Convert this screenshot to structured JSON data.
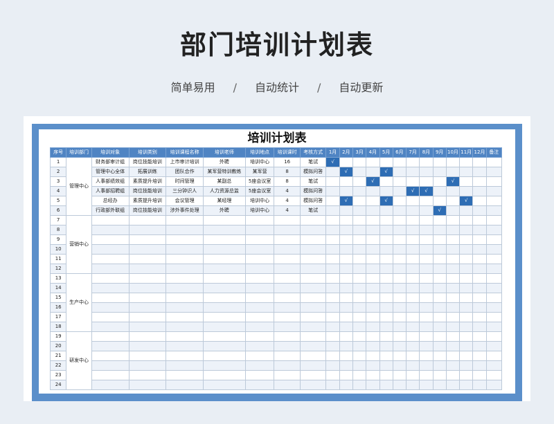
{
  "page": {
    "title": "部门培训计划表",
    "tags": [
      "简单易用",
      "自动统计",
      "自动更新"
    ],
    "separator": "/"
  },
  "sheet": {
    "title": "培训计划表",
    "headers": [
      "序号",
      "培训部门",
      "培训对象",
      "培训类别",
      "培训课程名称",
      "培训老师",
      "培训地点",
      "培训课时",
      "考核方式",
      "1月",
      "2月",
      "3月",
      "4月",
      "5月",
      "6月",
      "7月",
      "8月",
      "9月",
      "10月",
      "11月",
      "12月",
      "备注"
    ],
    "mark": "√",
    "rows": [
      {
        "no": "1",
        "target": "财务部审计组",
        "category": "岗位技能培训",
        "course": "上市审计培训",
        "teacher": "外聘",
        "location": "培训中心",
        "hours": "16",
        "exam": "笔试",
        "months": [
          1
        ]
      },
      {
        "no": "2",
        "target": "管理中心全体",
        "category": "拓展训练",
        "course": "团队合作",
        "teacher": "某军营特训教练",
        "location": "某军营",
        "hours": "8",
        "exam": "模拟问答",
        "months": [
          2,
          5
        ]
      },
      {
        "no": "3",
        "target": "人事部绩效组",
        "category": "素质提升培训",
        "course": "时间管理",
        "teacher": "某副总",
        "location": "5座会议室",
        "hours": "8",
        "exam": "笔试",
        "months": [
          4,
          10
        ]
      },
      {
        "no": "4",
        "target": "人事部招聘组",
        "category": "岗位技能培训",
        "course": "三分钟识人",
        "teacher": "人力资源总监",
        "location": "5座会议室",
        "hours": "4",
        "exam": "模拟问答",
        "months": [
          7,
          8
        ]
      },
      {
        "no": "5",
        "target": "总经办",
        "category": "素质提升培训",
        "course": "会议管理",
        "teacher": "某经理",
        "location": "培训中心",
        "hours": "4",
        "exam": "模拟问答",
        "months": [
          2,
          5,
          11
        ]
      },
      {
        "no": "6",
        "target": "行政部外联组",
        "category": "岗位技能培训",
        "course": "涉外事件处理",
        "teacher": "外聘",
        "location": "培训中心",
        "hours": "4",
        "exam": "笔试",
        "months": [
          9
        ]
      },
      {
        "no": "7"
      },
      {
        "no": "8"
      },
      {
        "no": "9"
      },
      {
        "no": "10"
      },
      {
        "no": "11"
      },
      {
        "no": "12"
      },
      {
        "no": "13"
      },
      {
        "no": "14"
      },
      {
        "no": "15"
      },
      {
        "no": "16"
      },
      {
        "no": "17"
      },
      {
        "no": "18"
      },
      {
        "no": "19"
      },
      {
        "no": "20"
      },
      {
        "no": "21"
      },
      {
        "no": "22"
      },
      {
        "no": "23"
      },
      {
        "no": "24"
      }
    ],
    "departments": [
      {
        "name": "管理中心",
        "span": 6
      },
      {
        "name": "营销中心",
        "span": 6
      },
      {
        "name": "生产中心",
        "span": 6
      },
      {
        "name": "研发中心",
        "span": 6
      }
    ]
  }
}
